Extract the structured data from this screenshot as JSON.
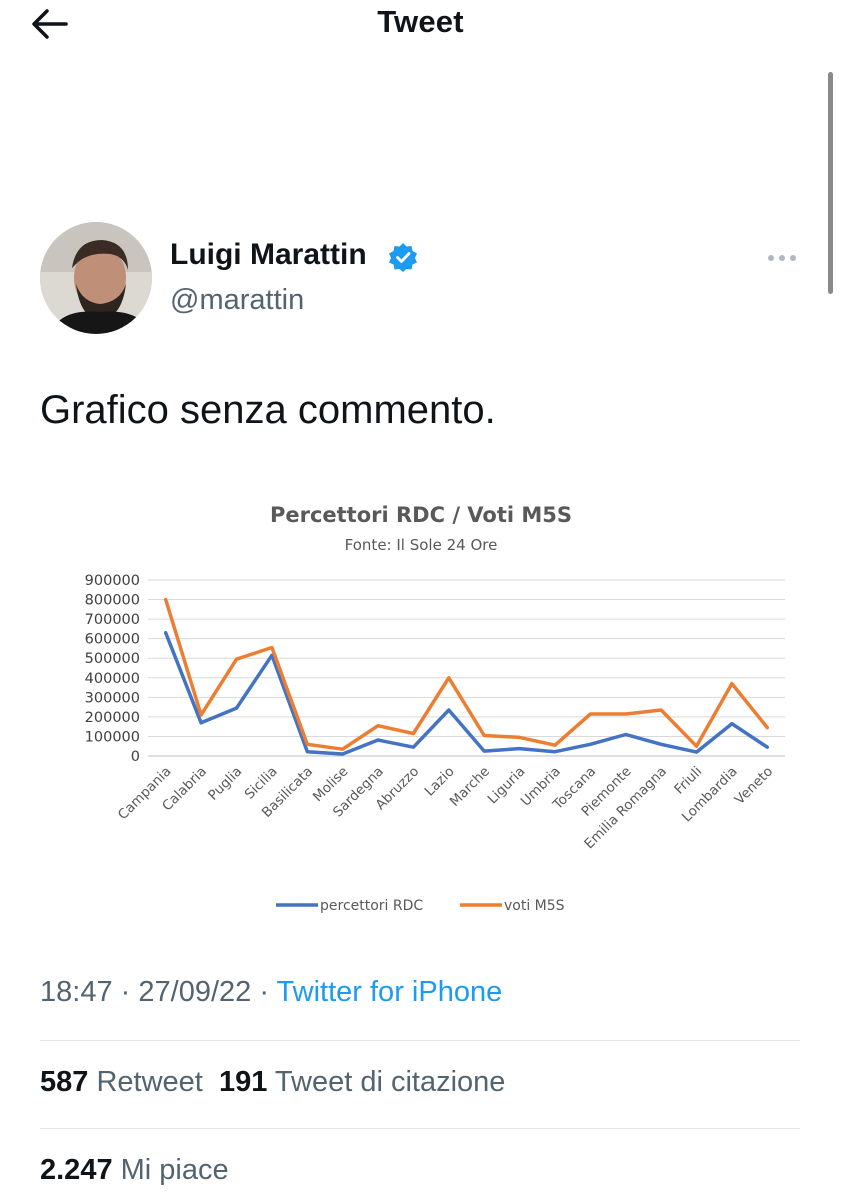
{
  "header": {
    "title": "Tweet"
  },
  "author": {
    "name": "Luigi Marattin",
    "handle": "@marattin"
  },
  "tweet": {
    "text": "Grafico senza commento."
  },
  "footer": {
    "time": "18:47",
    "date": "27/09/22",
    "separator": "·",
    "source": "Twitter for iPhone"
  },
  "stats": {
    "retweets_count": "587",
    "retweets_label": "Retweet",
    "quotes_count": "191",
    "quotes_label": "Tweet di citazione",
    "likes_count": "2.247",
    "likes_label": "Mi piace"
  },
  "colors": {
    "accent": "#1d9bf0",
    "series_rdc": "#4472c4",
    "series_m5s": "#ed7d31"
  },
  "icons": {
    "back": "arrow-left-icon",
    "verified": "verified-badge-icon",
    "more": "more-horizontal-icon"
  },
  "chart_data": {
    "type": "line",
    "title": "Percettori RDC / Voti M5S",
    "subtitle": "Fonte: Il Sole 24 Ore",
    "categories": [
      "Campania",
      "Calabria",
      "Puglia",
      "Sicilia",
      "Basilicata",
      "Molise",
      "Sardegna",
      "Abruzzo",
      "Lazio",
      "Marche",
      "Liguria",
      "Umbria",
      "Toscana",
      "Piemonte",
      "Emilia Romagna",
      "Friuli",
      "Lombardia",
      "Veneto"
    ],
    "y_ticks": [
      "0",
      "100000",
      "200000",
      "300000",
      "400000",
      "500000",
      "600000",
      "700000",
      "800000",
      "900000"
    ],
    "ylim": [
      0,
      900000
    ],
    "grid": true,
    "legend_position": "bottom",
    "series": [
      {
        "name": "percettori RDC",
        "color": "#4472c4",
        "values": [
          630000,
          170000,
          245000,
          515000,
          22000,
          10000,
          82000,
          45000,
          235000,
          25000,
          38000,
          22000,
          60000,
          110000,
          60000,
          20000,
          165000,
          45000
        ]
      },
      {
        "name": "voti M5S",
        "color": "#ed7d31",
        "values": [
          800000,
          210000,
          495000,
          555000,
          60000,
          35000,
          155000,
          115000,
          400000,
          105000,
          95000,
          55000,
          215000,
          215000,
          235000,
          50000,
          370000,
          145000
        ]
      }
    ]
  }
}
